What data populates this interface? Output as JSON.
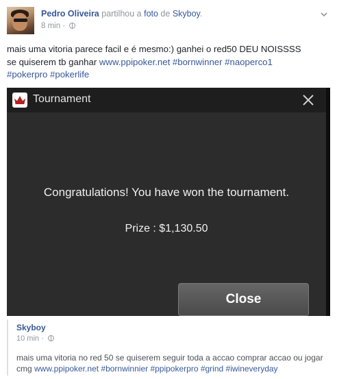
{
  "post": {
    "author": "Pedro Oliveira",
    "action_text": " partilhou a ",
    "photo_link": "foto",
    "of_text": " de ",
    "source": "Skyboy",
    "period": ".",
    "time": "8 min",
    "separator": " · ",
    "body": {
      "line1": "mais uma vitoria parece facil e é mesmo:) ganhei o red50 DEU NOISSSS",
      "line2_prefix": "se quiserem tb ganhar ",
      "line2_link": "www.ppipoker.net",
      "line2_tags": " #bornwinner #naoperco1",
      "line3_tags": "#pokerpro #pokerlife"
    }
  },
  "photo": {
    "window_title": "Tournament",
    "message": "Congratulations! You have won the tournament.",
    "prize": "Prize : $1,130.50",
    "close_label": "Close",
    "accent_color": "#b22222"
  },
  "shared": {
    "name": "Skyboy",
    "time": "10 min",
    "separator": " · ",
    "line1": "mais uma vitoria no red 50 se quiserem seguir toda a accao comprar accao ou jogar",
    "line2_prefix": "cmg ",
    "line2_links": "www.ppipoker.net #bornwinnier #ppipokerpro #grind #iwineveryday"
  },
  "icons": [
    "avatar",
    "globe-icon",
    "chevron-down-icon",
    "tournament-app-icon",
    "close-x-icon"
  ]
}
